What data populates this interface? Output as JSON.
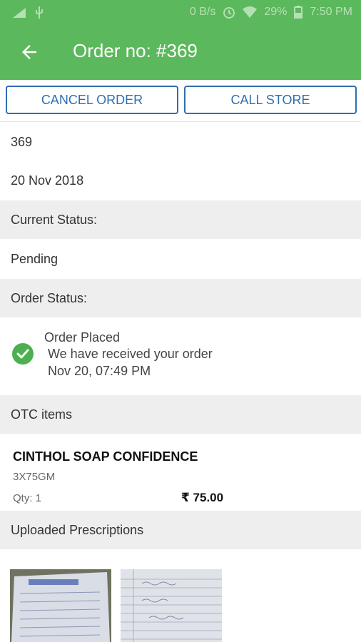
{
  "status_bar": {
    "net_speed": "0 B/s",
    "battery": "29%",
    "time": "7:50 PM"
  },
  "app_bar": {
    "title": "Order no: #369",
    "icons": {
      "back": "arrow-back-icon"
    }
  },
  "actions": {
    "cancel_label": "CANCEL ORDER",
    "call_label": "CALL STORE"
  },
  "order": {
    "number": "369",
    "date": "20 Nov 2018",
    "current_status_label": "Current Status:",
    "current_status": "Pending",
    "order_status_label": "Order Status:",
    "timeline": [
      {
        "title": "Order Placed",
        "message": "We have received your order",
        "time": "Nov 20, 07:49 PM",
        "icon": "check-circle-icon"
      }
    ]
  },
  "otc": {
    "section_label": "OTC items",
    "items": [
      {
        "name": "CINTHOL SOAP CONFIDENCE",
        "pack": "3X75GM",
        "qty": "Qty: 1",
        "price": "₹ 75.00"
      }
    ]
  },
  "prescriptions": {
    "section_label": "Uploaded Prescriptions",
    "images": [
      "prescription-image-1",
      "prescription-image-2"
    ]
  },
  "colors": {
    "primary": "#5cb85c",
    "button_outline": "#2f6fb0",
    "section_grey": "#eeeeee",
    "check_green": "#4caf50"
  }
}
